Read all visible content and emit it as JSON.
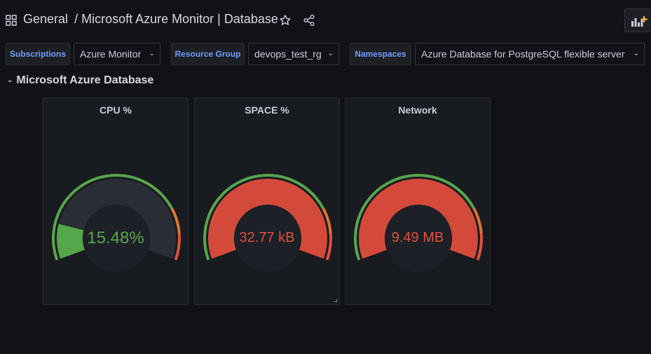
{
  "header": {
    "folder": "General",
    "separator": "/",
    "dashboard_title": "Microsoft Azure Monitor | Database"
  },
  "variables": [
    {
      "label": "Subscriptions",
      "value": "Azure Monitor"
    },
    {
      "label": "Resource Group",
      "value": "devops_test_rg"
    },
    {
      "label": "Namespaces",
      "value": "Azure Database for PostgreSQL flexible server"
    }
  ],
  "row": {
    "title": "Microsoft Azure Database"
  },
  "panels": [
    {
      "title": "CPU %",
      "value": "15.48%",
      "fill_fraction": 0.1548,
      "value_color": "#56a64b",
      "fill_color": "#56a64b"
    },
    {
      "title": "SPACE %",
      "value": "32.77 kB",
      "fill_fraction": 1.0,
      "value_color": "#e0513d",
      "fill_color": "#d44a3a"
    },
    {
      "title": "Network",
      "value": "9.49 MB",
      "fill_fraction": 1.0,
      "value_color": "#e0513d",
      "fill_color": "#d44a3a"
    }
  ],
  "colors": {
    "threshold_green": "#56a64b",
    "threshold_orange": "#e0752d",
    "threshold_red": "#e0513d",
    "gauge_track": "#2a2d35",
    "accent_blue": "#6e9fff"
  }
}
